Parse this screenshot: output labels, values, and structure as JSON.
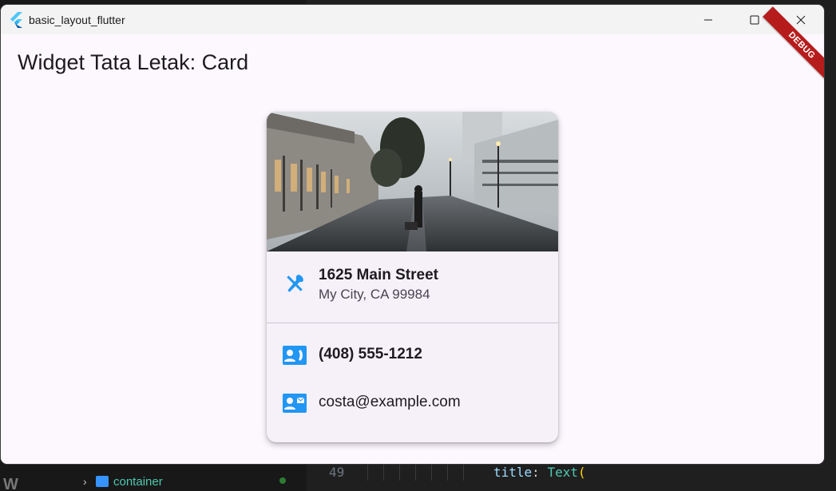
{
  "window": {
    "title": "basic_layout_flutter",
    "minimize_icon": "minimize-icon",
    "maximize_icon": "maximize-icon",
    "close_icon": "close-icon"
  },
  "page": {
    "title": "Widget Tata Letak: Card",
    "debug_banner": "DEBUG"
  },
  "card": {
    "image_icon": "city-street-photo",
    "address": {
      "icon": "restaurant-icon",
      "title": "1625 Main Street",
      "subtitle": "My City, CA 99984"
    },
    "phone": {
      "icon": "contact-phone-icon",
      "text": "(408) 555-1212"
    },
    "email": {
      "icon": "contact-mail-icon",
      "text": "costa@example.com"
    }
  },
  "background_ide": {
    "tree_item": "container",
    "line_number": "49",
    "code_key": "title",
    "code_sep": ":",
    "code_class": "Text",
    "code_paren": "("
  },
  "colors": {
    "accent": "#2196f3",
    "page_bg": "#fdf7fe",
    "card_bg": "#f6f1f8",
    "debug_ribbon": "#b71c1c"
  }
}
